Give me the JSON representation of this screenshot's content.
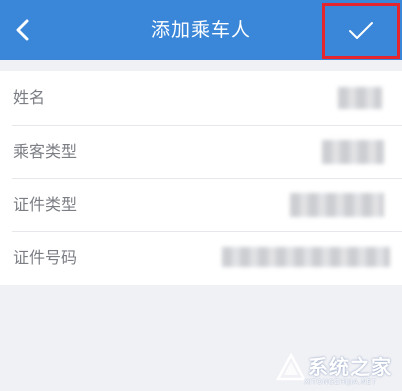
{
  "header": {
    "title": "添加乘车人",
    "back_icon": "chevron-left-icon",
    "confirm_icon": "check-icon"
  },
  "form": {
    "rows": [
      {
        "label": "姓名"
      },
      {
        "label": "乘客类型"
      },
      {
        "label": "证件类型"
      },
      {
        "label": "证件号码"
      }
    ]
  },
  "watermark": {
    "brand": "系统之家",
    "url": "XITONGZHIJIA.NET"
  },
  "colors": {
    "header_bg": "#3a86d8",
    "highlight_border": "#e5262e",
    "page_bg": "#f0f1f5"
  }
}
